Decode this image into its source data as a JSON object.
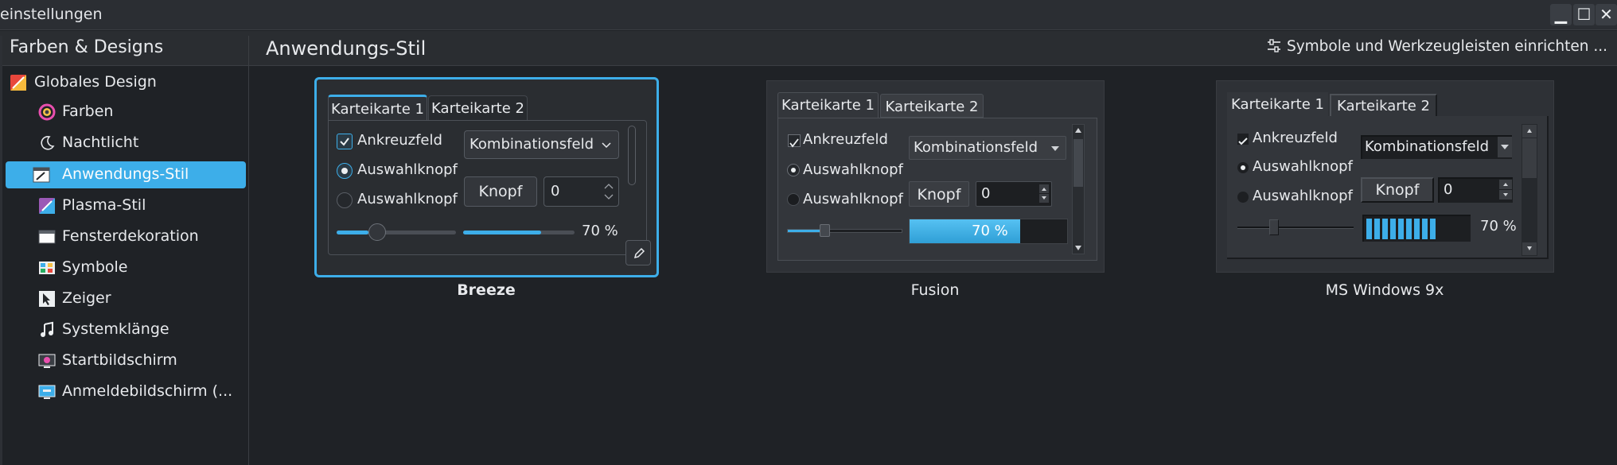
{
  "window": {
    "title": "einstellungen",
    "controls": {
      "minimize": "▁",
      "maximize": "☐",
      "close": "✕"
    }
  },
  "header": {
    "section_title": "Farben & Designs",
    "page_title": "Anwendungs-Stil",
    "config_button": "Symbole und Werkzeugleisten einrichten ..."
  },
  "sidebar": {
    "items": [
      {
        "label": "Globales Design",
        "icon": "global-theme-icon"
      },
      {
        "label": "Farben",
        "icon": "colors-icon"
      },
      {
        "label": "Nachtlicht",
        "icon": "night-light-icon"
      },
      {
        "label": "Anwendungs-Stil",
        "icon": "application-style-icon",
        "selected": true
      },
      {
        "label": "Plasma-Stil",
        "icon": "plasma-style-icon"
      },
      {
        "label": "Fensterdekoration",
        "icon": "window-decoration-icon"
      },
      {
        "label": "Symbole",
        "icon": "icons-icon"
      },
      {
        "label": "Zeiger",
        "icon": "cursor-icon"
      },
      {
        "label": "Systemklänge",
        "icon": "system-sounds-icon"
      },
      {
        "label": "Startbildschirm",
        "icon": "splash-screen-icon"
      },
      {
        "label": "Anmeldebildschirm (...",
        "icon": "login-screen-icon"
      }
    ]
  },
  "styles": [
    {
      "name": "Breeze",
      "selected": true,
      "tab1": "Karteikarte 1",
      "tab2": "Karteikarte 2",
      "checkbox": "Ankreuzfeld",
      "radio1": "Auswahlknopf",
      "radio2": "Auswahlknopf",
      "combo": "Kombinationsfeld",
      "button": "Knopf",
      "spin": "0",
      "progress_label": "70 %",
      "progress": 0.7
    },
    {
      "name": "Fusion",
      "tab1": "Karteikarte 1",
      "tab2": "Karteikarte 2",
      "checkbox": "Ankreuzfeld",
      "radio1": "Auswahlknopf",
      "radio2": "Auswahlknopf",
      "combo": "Kombinationsfeld",
      "button": "Knopf",
      "spin": "0",
      "progress_label": "70 %",
      "progress": 0.7
    },
    {
      "name": "MS Windows 9x",
      "tab1": "Karteikarte 1",
      "tab2": "Karteikarte 2",
      "checkbox": "Ankreuzfeld",
      "radio1": "Auswahlknopf",
      "radio2": "Auswahlknopf",
      "combo": "Kombinationsfeld",
      "button": "Knopf",
      "spin": "0",
      "progress_label": "70 %",
      "progress": 0.7
    }
  ],
  "colors": {
    "accent": "#3daee9",
    "window_bg": "#1f2226",
    "panel_bg": "#2a2d31"
  }
}
